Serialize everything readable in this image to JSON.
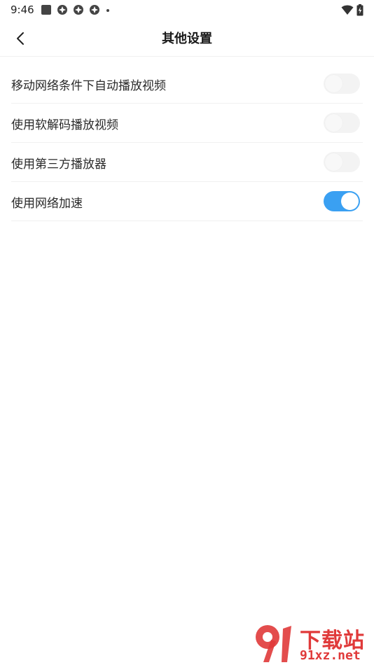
{
  "status_bar": {
    "time": "9:46",
    "left_icons": [
      "square-notification-icon",
      "app-notification-icon",
      "app-notification-icon",
      "app-notification-icon",
      "dot-icon"
    ],
    "right_icons": [
      "wifi-icon",
      "battery-charging-icon"
    ]
  },
  "header": {
    "title": "其他设置",
    "back_icon": "chevron-left-icon"
  },
  "settings": [
    {
      "label": "移动网络条件下自动播放视频",
      "enabled": false
    },
    {
      "label": "使用软解码播放视频",
      "enabled": false
    },
    {
      "label": "使用第三方播放器",
      "enabled": false
    },
    {
      "label": "使用网络加速",
      "enabled": true
    }
  ],
  "colors": {
    "toggle_on": "#3aa0f2",
    "toggle_off": "#f3f3f3",
    "watermark": "#e03a3a"
  },
  "watermark": {
    "title": "下载站",
    "site": "91xz.net"
  }
}
